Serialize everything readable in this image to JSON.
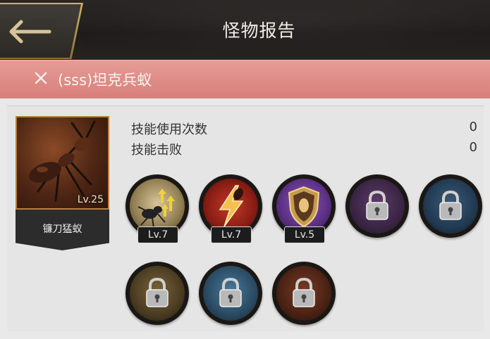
{
  "header": {
    "title": "怪物报告",
    "back_icon": "arrow-left-icon"
  },
  "subheader": {
    "close_icon": "close-icon",
    "title": "(sss)坦克兵蚁"
  },
  "unit": {
    "name": "镰刀猛蚁",
    "level": "Lv.25"
  },
  "stats": [
    {
      "label": "技能使用次数",
      "value": "0"
    },
    {
      "label": "技能击败",
      "value": "0"
    }
  ],
  "skills": [
    {
      "icon": "ant-upgrade-icon",
      "level": "Lv.7",
      "locked": false
    },
    {
      "icon": "lightning-strike-icon",
      "level": "Lv.7",
      "locked": false
    },
    {
      "icon": "shield-emblem-icon",
      "level": "Lv.5",
      "locked": false
    },
    {
      "icon": "lock-icon",
      "locked": true
    },
    {
      "icon": "lock-icon",
      "locked": true
    },
    {
      "icon": "lock-icon",
      "locked": true
    },
    {
      "icon": "lock-icon",
      "locked": true
    },
    {
      "icon": "lock-icon",
      "locked": true
    }
  ]
}
